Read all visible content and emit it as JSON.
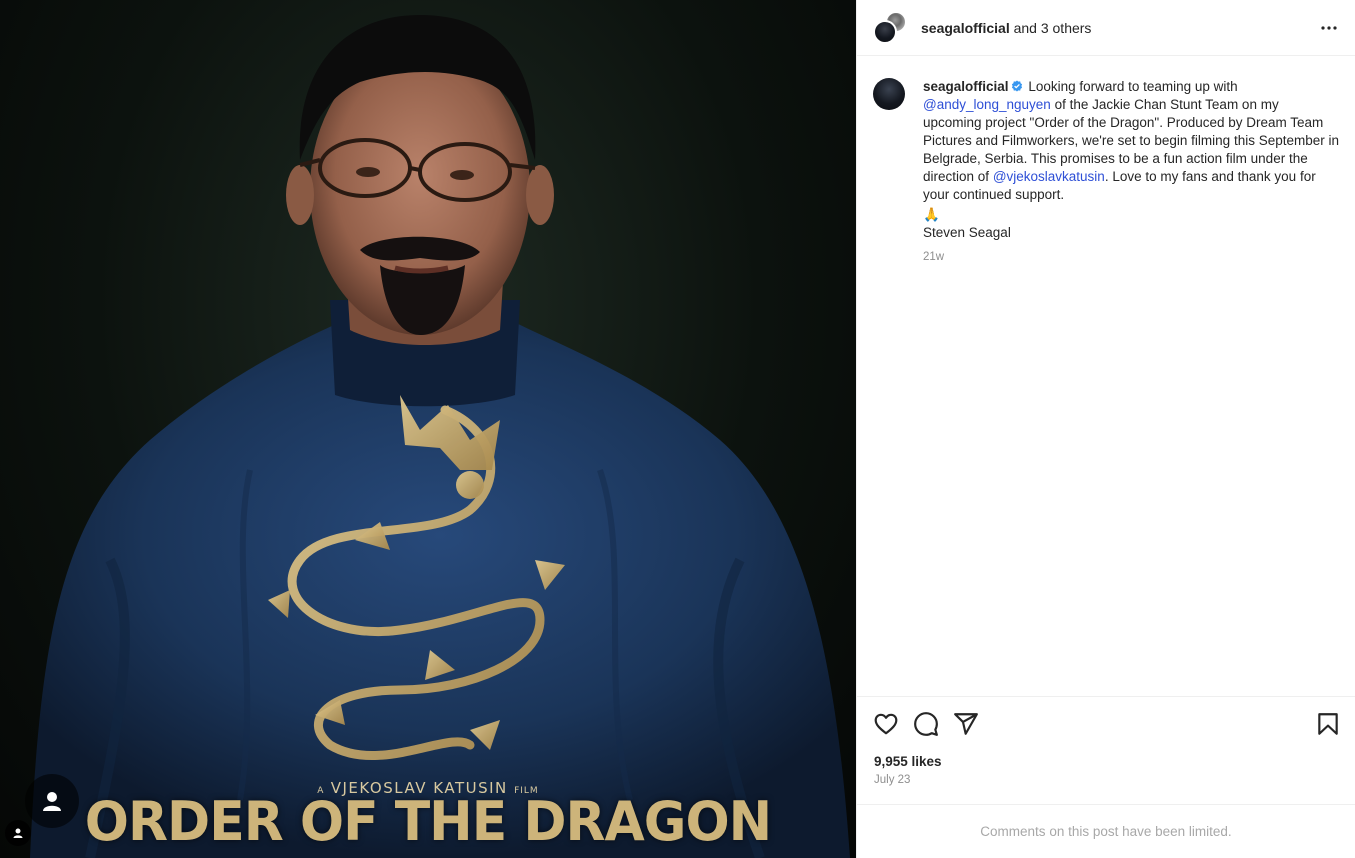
{
  "media": {
    "credit_prefix": "A",
    "credit_name": "VJEKOSLAV KATUSIN",
    "credit_suffix": "FILM",
    "title": "ORDER OF THE DRAGON"
  },
  "header": {
    "username": "seagalofficial",
    "collab_text": "and 3 others"
  },
  "caption": {
    "username": "seagalofficial",
    "text_1": "Looking forward to teaming up with",
    "mention_1": "@andy_long_nguyen",
    "text_2": "of the Jackie Chan Stunt Team on my upcoming project \"Order of the Dragon\". Produced by Dream Team Pictures and Filmworkers, we're set to begin filming this September in Belgrade, Serbia. This promises to be a fun action film under the direction of",
    "mention_2": "@vjekoslavkatusin",
    "text_3": ". Love to my fans and thank you for your continued support.",
    "emoji": "🙏",
    "signature": "Steven Seagal",
    "age": "21w"
  },
  "stats": {
    "likes": "9,955 likes",
    "date": "July 23"
  },
  "comments_notice": "Comments on this post have been limited.",
  "colors": {
    "mention": "#2e4fd6",
    "verified": "#3897f0",
    "robe": "#1c3a63",
    "dragon_gold": "#c9ad6a"
  },
  "icons": [
    "more-icon",
    "verified-icon",
    "heart-icon",
    "comment-icon",
    "share-icon",
    "bookmark-icon",
    "user-icon"
  ]
}
